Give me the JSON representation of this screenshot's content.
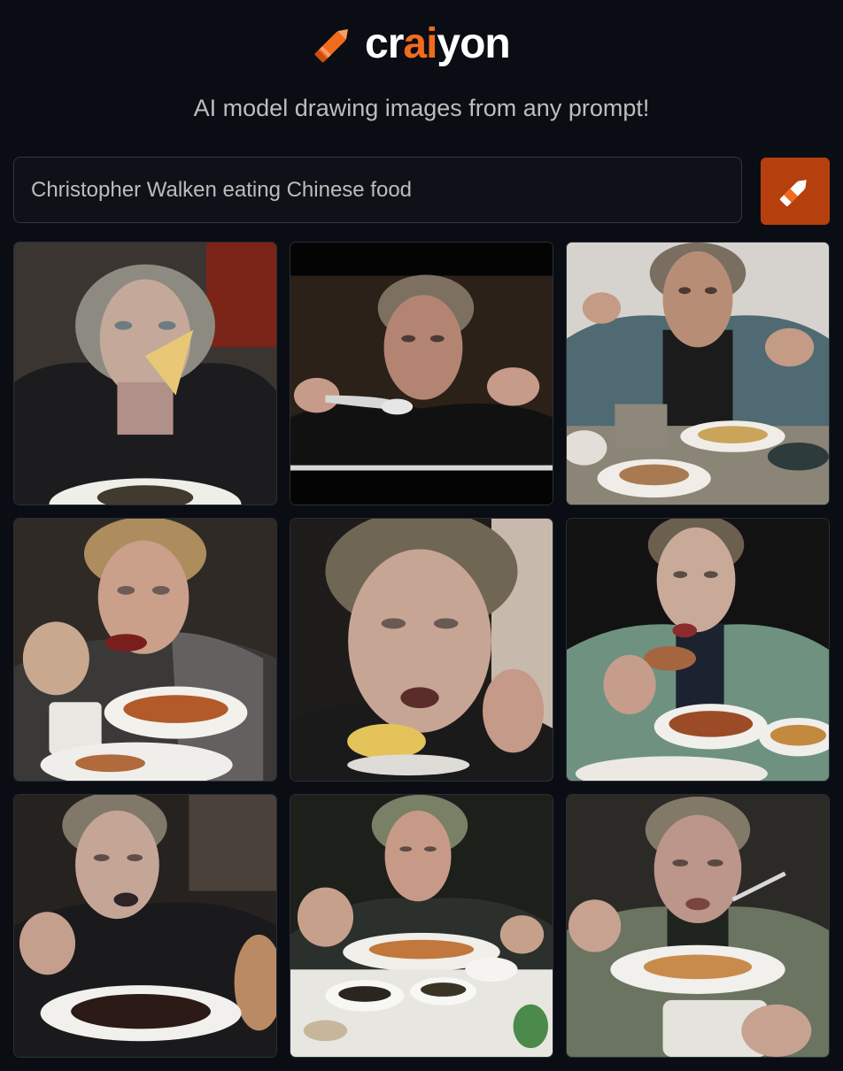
{
  "header": {
    "logo_icon": "crayon-icon",
    "wordmark_prefix": "cr",
    "wordmark_accent": "ai",
    "wordmark_suffix": "yon",
    "tagline": "AI model drawing images from any prompt!"
  },
  "prompt": {
    "value": "Christopher Walken eating Chinese food",
    "button_icon": "pencil-icon"
  },
  "colors": {
    "background": "#0b0d14",
    "accent": "#f26b1d",
    "button": "#b5400e"
  },
  "gallery": {
    "count": 9
  }
}
